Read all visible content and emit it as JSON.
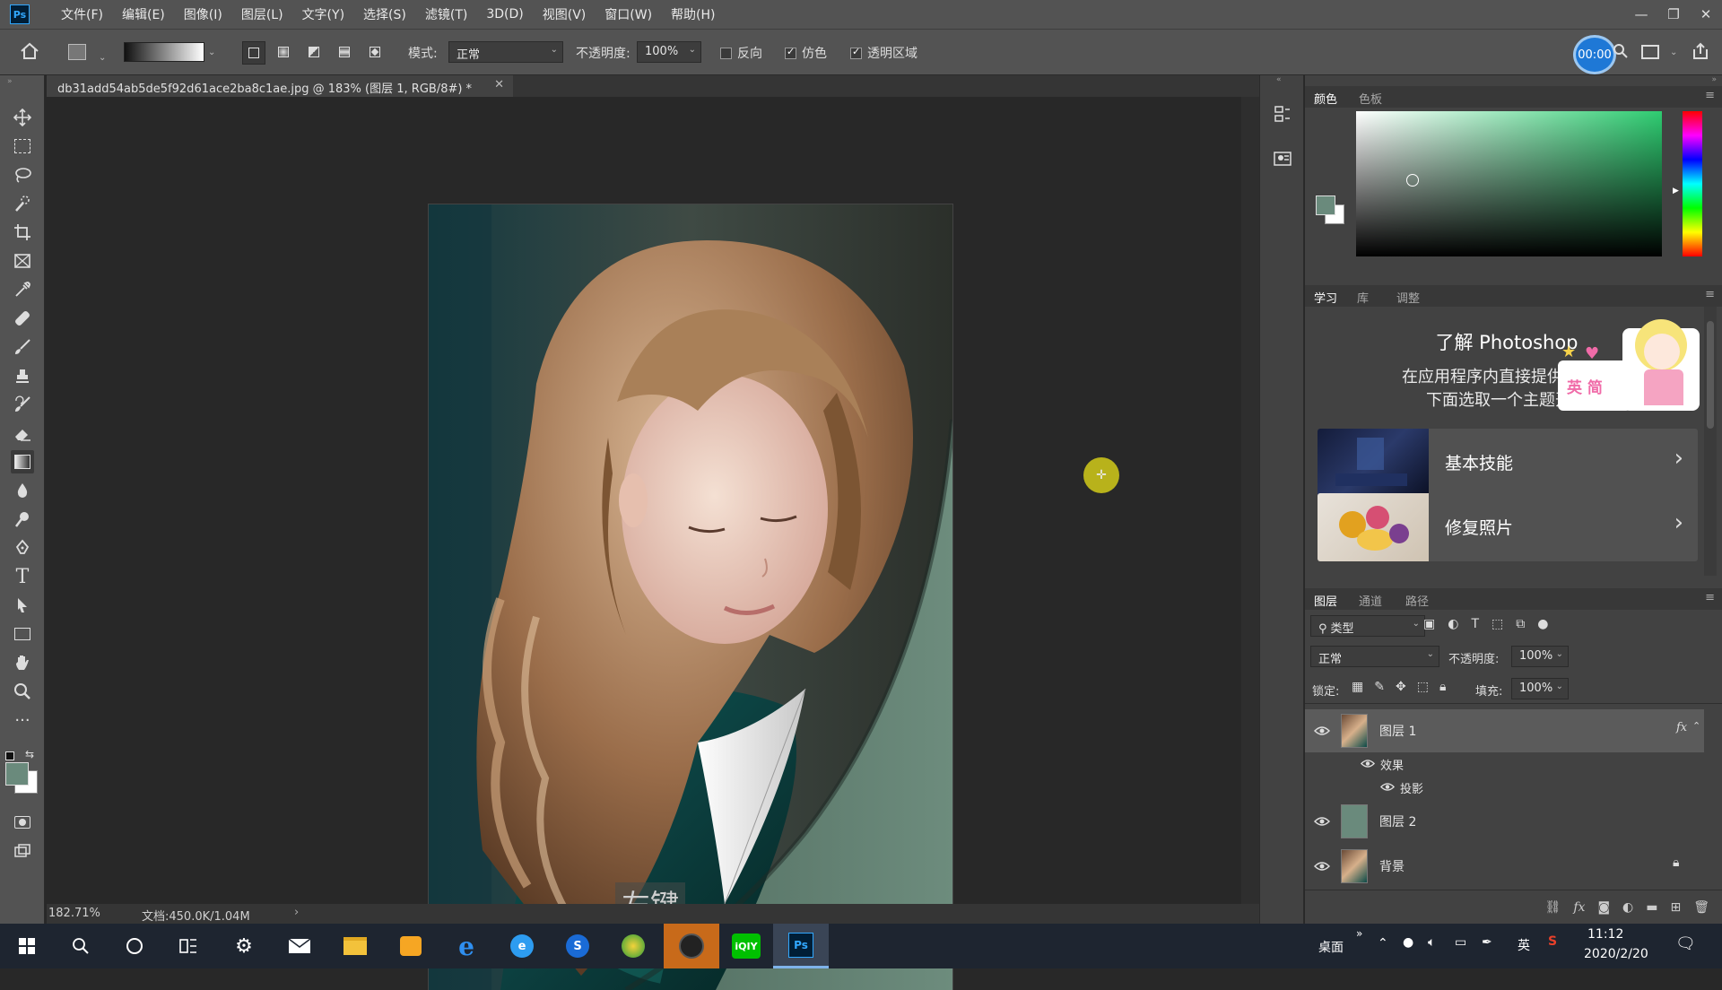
{
  "app": {
    "logo": "Ps",
    "menu": [
      "文件(F)",
      "编辑(E)",
      "图像(I)",
      "图层(L)",
      "文字(Y)",
      "选择(S)",
      "滤镜(T)",
      "3D(D)",
      "视图(V)",
      "窗口(W)",
      "帮助(H)"
    ],
    "timer": "00:00"
  },
  "options": {
    "mode_label": "模式:",
    "mode_value": "正常",
    "opacity_label": "不透明度:",
    "opacity_value": "100%",
    "reverse_label": "反向",
    "reverse_checked": false,
    "dither_label": "仿色",
    "dither_checked": true,
    "transparency_label": "透明区域",
    "transparency_checked": true
  },
  "document": {
    "tab_title": "db31add54ab5de5f92d61ace2ba8c1ae.jpg @ 183% (图层 1, RGB/8#) *",
    "overlay_caption": "左键"
  },
  "status": {
    "zoom": "182.71%",
    "doc_size": "文档:450.0K/1.04M",
    "arrow": "›"
  },
  "color_panel": {
    "tabs": [
      "颜色",
      "色板"
    ],
    "fg_color": "#6a8a7c",
    "bg_color": "#ffffff",
    "hue_color": "#2ecc71"
  },
  "learn_panel": {
    "tabs": [
      "学习",
      "库",
      "调整"
    ],
    "title": "了解 Photoshop",
    "subtitle1": "在应用程序内直接提供的分步",
    "subtitle2": "下面选取一个主题开始",
    "sticker_text": "英 简",
    "cards": [
      {
        "label": "基本技能",
        "icon": "chevron-right-icon"
      },
      {
        "label": "修复照片",
        "icon": "chevron-right-icon"
      }
    ]
  },
  "layers_panel": {
    "tabs": [
      "图层",
      "通道",
      "路径"
    ],
    "filter_label": "类型",
    "blend_mode": "正常",
    "opacity_label": "不透明度:",
    "opacity_value": "100%",
    "lock_label": "锁定:",
    "fill_label": "填充:",
    "fill_value": "100%",
    "layers": [
      {
        "name": "图层 1",
        "fx": "fx",
        "selected": true
      },
      {
        "name": "效果"
      },
      {
        "name": "投影"
      },
      {
        "name": "图层 2"
      },
      {
        "name": "背景",
        "locked": true
      }
    ]
  },
  "taskbar": {
    "desktop_label": "桌面",
    "chevron": "»",
    "ime": "英",
    "time": "11:12",
    "date": "2020/2/20"
  }
}
